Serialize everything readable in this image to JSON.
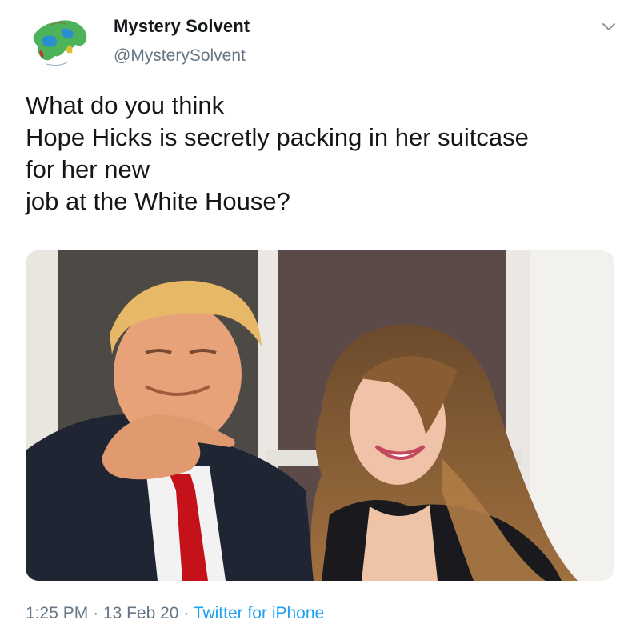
{
  "tweet": {
    "author_name": "Mystery Solvent",
    "author_handle": "@MysterySolvent",
    "text_lines": [
      "What do you think",
      "Hope Hicks is secretly packing in her suitcase",
      "for her new",
      "job at the White House?"
    ],
    "time": "1:25 PM",
    "date": "13 Feb 20",
    "separator": "·",
    "source": "Twitter for iPhone",
    "avatar_icon": "map-avatar-icon",
    "menu_icon": "chevron-down-icon",
    "media_alt": "Photo of a man in a dark suit and red tie pointing beside a smiling woman with long hair in front of a white door"
  },
  "colors": {
    "text": "#14171a",
    "secondary": "#657786",
    "link": "#1da1f2"
  }
}
